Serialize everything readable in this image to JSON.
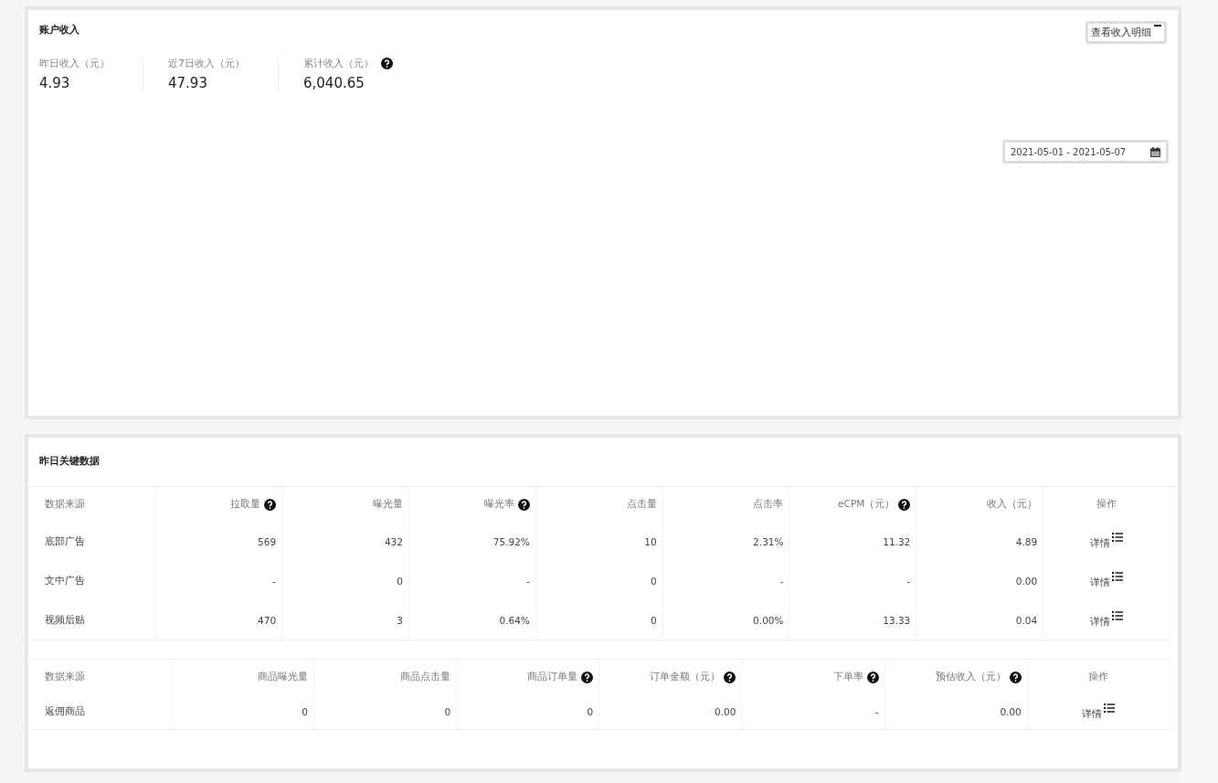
{
  "income_card": {
    "title": "账户收入",
    "detail_button": "查看收入明细",
    "stats": [
      {
        "label": "昨日收入（元）",
        "value": "4.93",
        "help": false
      },
      {
        "label": "近7日收入（元）",
        "value": "47.93",
        "help": false
      },
      {
        "label": "累计收入（元）",
        "value": "6,040.65",
        "help": true
      }
    ],
    "date_range": "2021-05-01 - 2021-05-07"
  },
  "key_data_card": {
    "title": "昨日关键数据",
    "tables": [
      {
        "columns": [
          {
            "label": "数据来源",
            "help": false
          },
          {
            "label": "拉取量",
            "help": true
          },
          {
            "label": "曝光量",
            "help": false
          },
          {
            "label": "曝光率",
            "help": true
          },
          {
            "label": "点击量",
            "help": false
          },
          {
            "label": "点击率",
            "help": false
          },
          {
            "label": "eCPM（元）",
            "help": true
          },
          {
            "label": "收入（元）",
            "help": false
          },
          {
            "label": "操作",
            "help": false
          }
        ],
        "rows": [
          {
            "cells": [
              "底部广告",
              "569",
              "432",
              "75.92%",
              "10",
              "2.31%",
              "11.32",
              "4.89"
            ],
            "action": "详情"
          },
          {
            "cells": [
              "文中广告",
              "-",
              "0",
              "-",
              "0",
              "-",
              "-",
              "0.00"
            ],
            "action": "详情"
          },
          {
            "cells": [
              "视频后贴",
              "470",
              "3",
              "0.64%",
              "0",
              "0.00%",
              "13.33",
              "0.04"
            ],
            "action": "详情"
          }
        ]
      },
      {
        "columns": [
          {
            "label": "数据来源",
            "help": false
          },
          {
            "label": "商品曝光量",
            "help": false
          },
          {
            "label": "商品点击量",
            "help": false
          },
          {
            "label": "商品订单量",
            "help": true
          },
          {
            "label": "订单金额（元）",
            "help": true
          },
          {
            "label": "下单率",
            "help": true
          },
          {
            "label": "预估收入（元）",
            "help": true
          },
          {
            "label": "操作",
            "help": false
          }
        ],
        "rows": [
          {
            "cells": [
              "返佣商品",
              "0",
              "0",
              "0",
              "0.00",
              "-",
              "0.00"
            ],
            "action": "详情"
          }
        ]
      }
    ]
  }
}
